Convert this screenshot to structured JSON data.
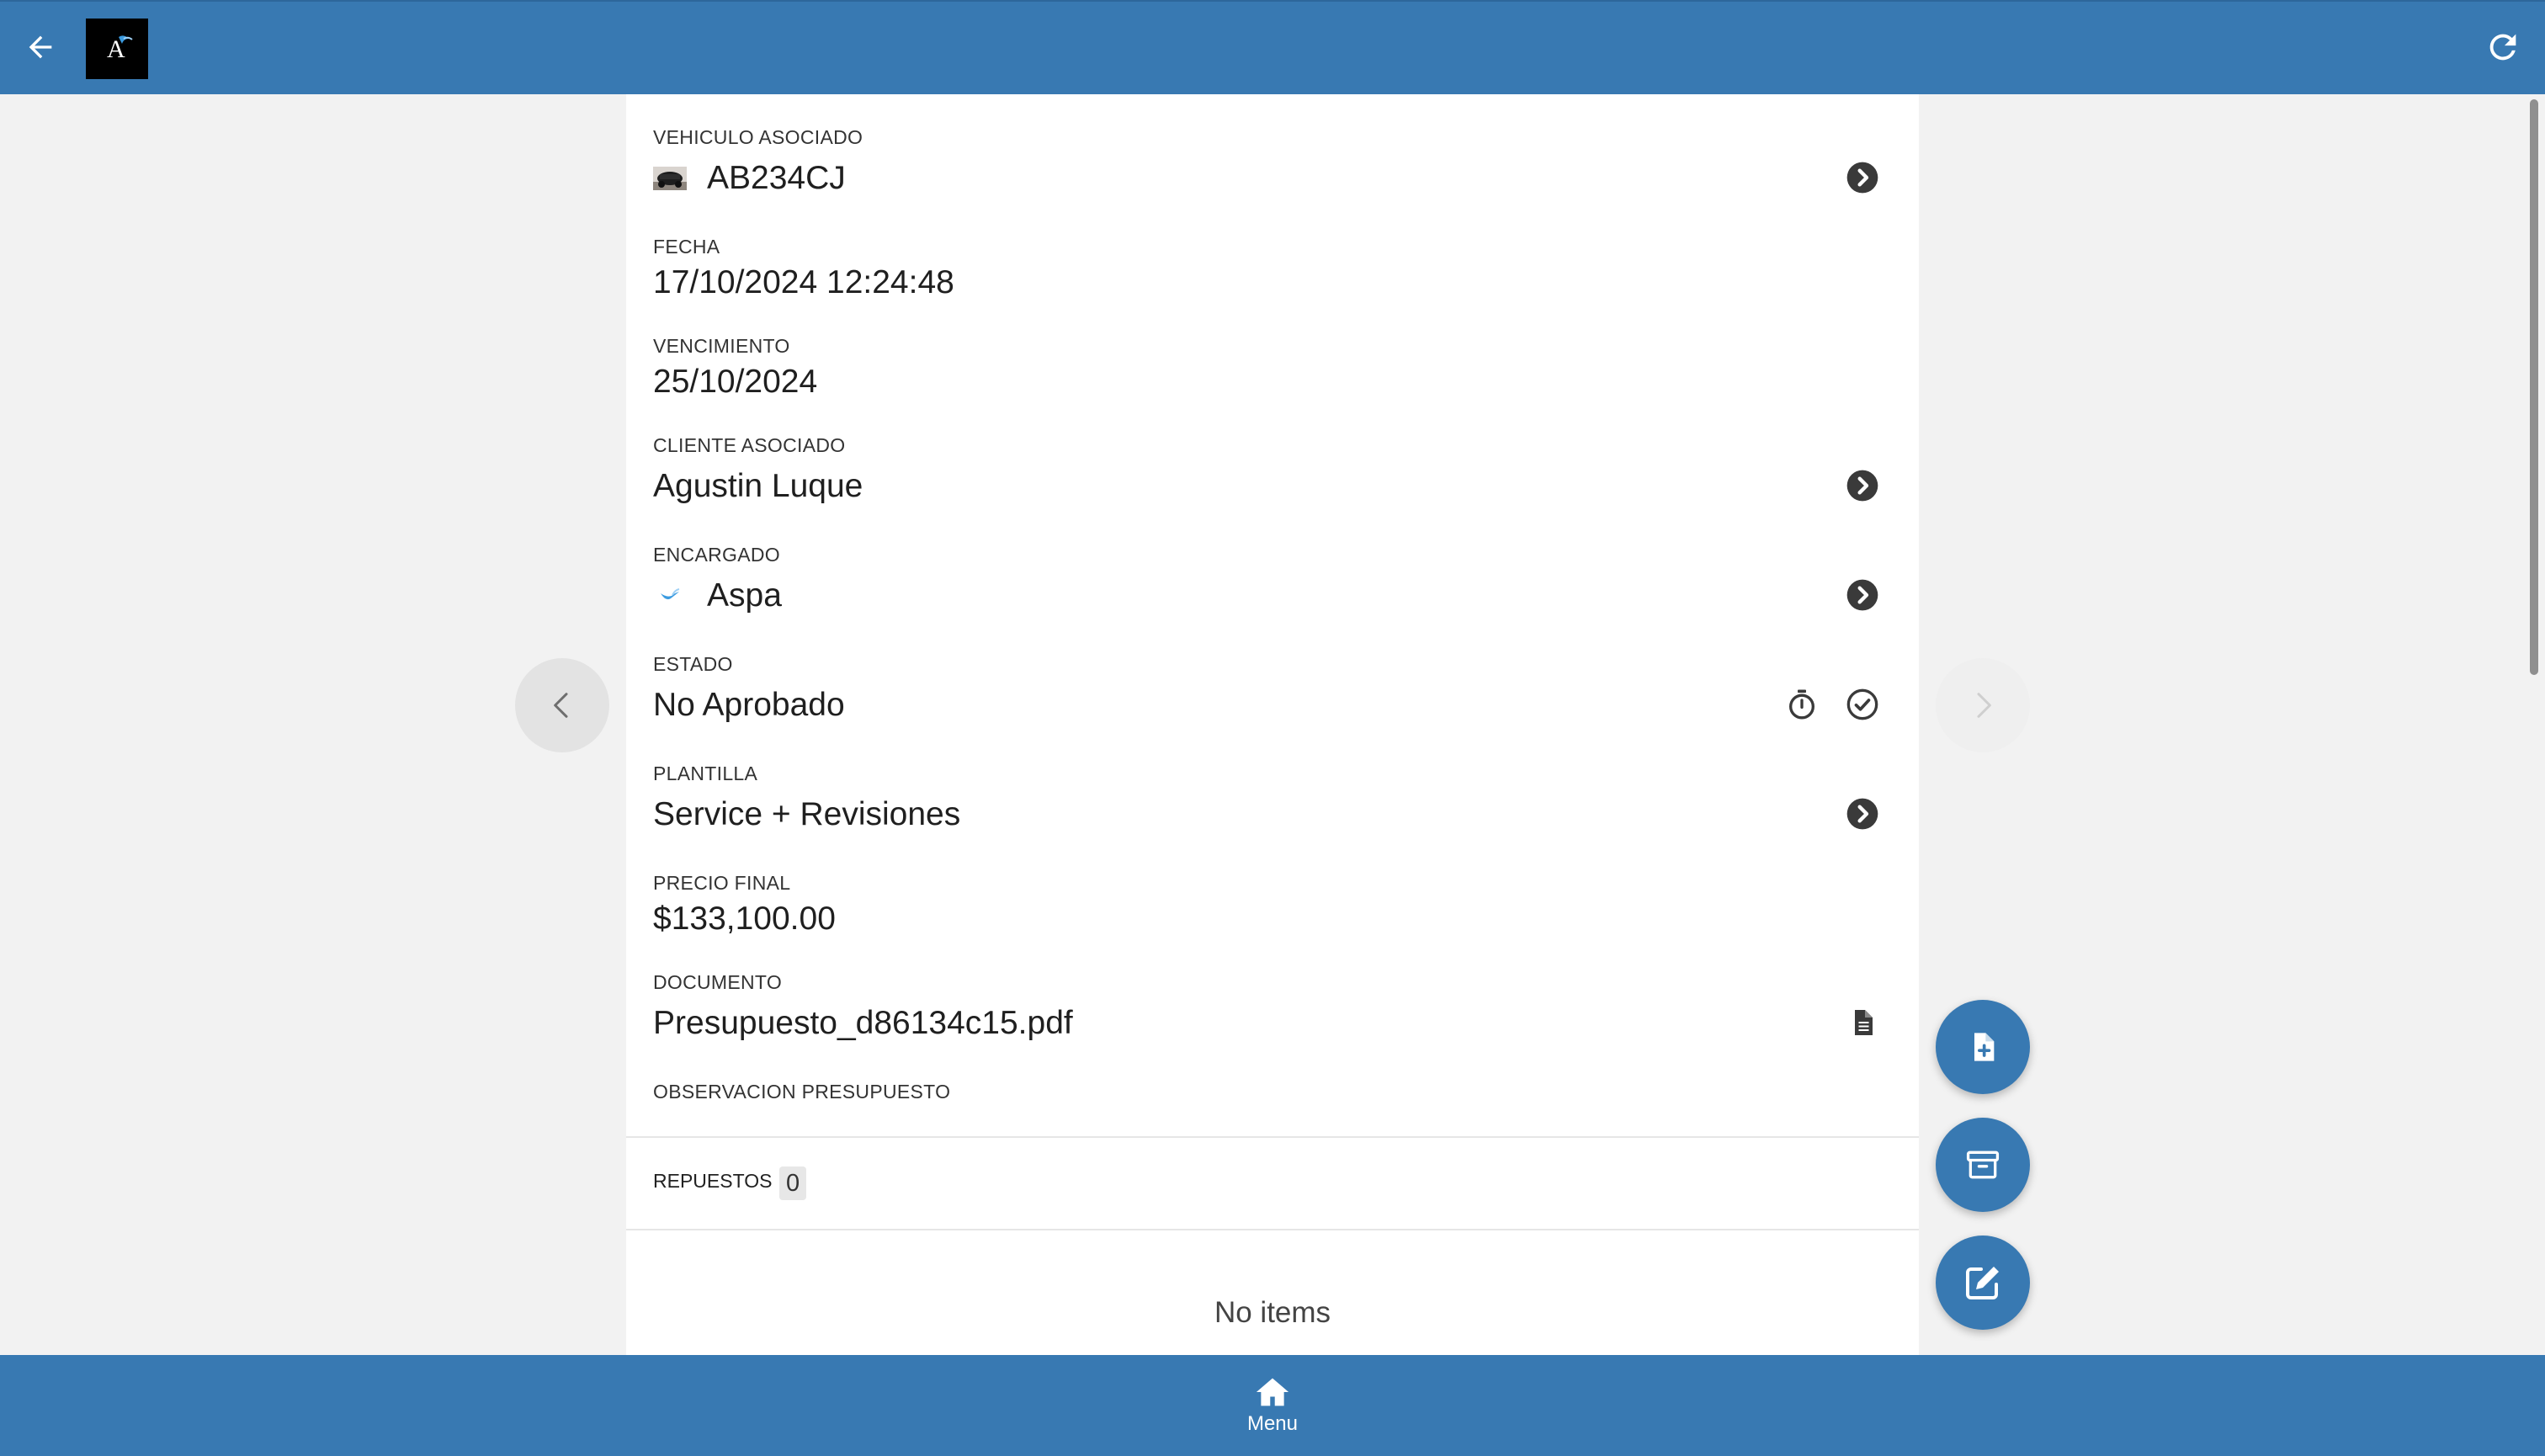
{
  "colors": {
    "primary": "#3879b2",
    "icon_dark": "#3a3a3a",
    "background": "#f2f2f2"
  },
  "header": {
    "back_icon": "arrow-left-icon",
    "logo_text": "A",
    "refresh_icon": "refresh-icon"
  },
  "fields": {
    "vehiculo": {
      "label": "VEHICULO ASOCIADO",
      "value": "AB234CJ",
      "thumb_icon": "car-thumbnail",
      "action_icon": "chevron-right-circle-icon"
    },
    "fecha": {
      "label": "FECHA",
      "value": "17/10/2024 12:24:48"
    },
    "vencimiento": {
      "label": "VENCIMIENTO",
      "value": "25/10/2024"
    },
    "cliente": {
      "label": "CLIENTE ASOCIADO",
      "value": "Agustin Luque",
      "action_icon": "chevron-right-circle-icon"
    },
    "encargado": {
      "label": "ENCARGADO",
      "value": "Aspa",
      "thumb_icon": "bird-logo",
      "action_icon": "chevron-right-circle-icon"
    },
    "estado": {
      "label": "ESTADO",
      "value": "No Aprobado",
      "icons": [
        "stopwatch-icon",
        "check-circle-icon"
      ]
    },
    "plantilla": {
      "label": "PLANTILLA",
      "value": "Service + Revisiones",
      "action_icon": "chevron-right-circle-icon"
    },
    "precio": {
      "label": "PRECIO FINAL",
      "value": "$133,100.00"
    },
    "documento": {
      "label": "DOCUMENTO",
      "value": "Presupuesto_d86134c15.pdf",
      "action_icon": "document-icon"
    },
    "observacion": {
      "label": "OBSERVACION PRESUPUESTO",
      "value": ""
    }
  },
  "repuestos": {
    "label": "REPUESTOS",
    "count": "0",
    "empty_text": "No items"
  },
  "navigation": {
    "prev_icon": "chevron-left-icon",
    "next_icon": "chevron-right-icon"
  },
  "fabs": [
    {
      "name": "add-document",
      "icon": "file-plus-icon"
    },
    {
      "name": "archive",
      "icon": "archive-icon"
    },
    {
      "name": "edit",
      "icon": "edit-icon"
    }
  ],
  "footer": {
    "menu_label": "Menu",
    "menu_icon": "home-icon"
  }
}
